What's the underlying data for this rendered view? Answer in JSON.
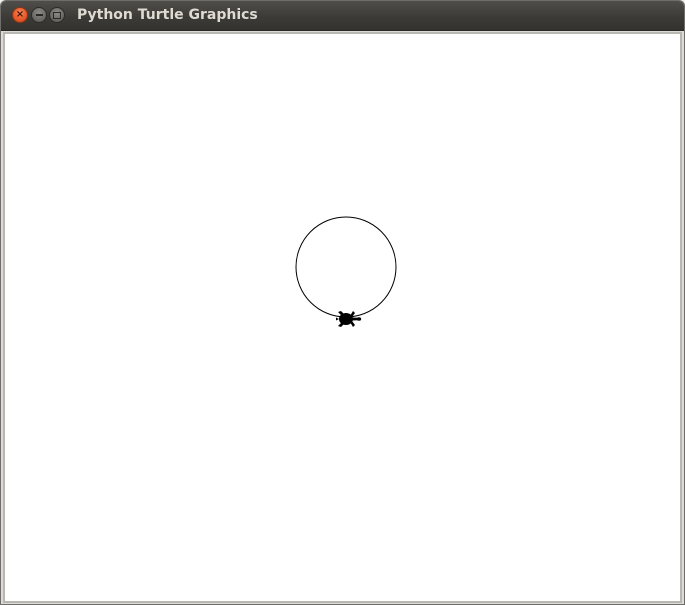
{
  "window": {
    "title": "Python Turtle Graphics",
    "controls": {
      "close_icon": "close-icon",
      "minimize_icon": "minimize-icon",
      "maximize_icon": "maximize-icon"
    }
  },
  "canvas": {
    "background": "#ffffff",
    "pen_color": "#000000",
    "drawing": "circle",
    "turtle_shape": "turtle",
    "turtle_heading": "east"
  },
  "colors": {
    "titlebar": "#3c3b37",
    "close_button": "#e95a2b",
    "title_text": "#dfdbd2"
  }
}
